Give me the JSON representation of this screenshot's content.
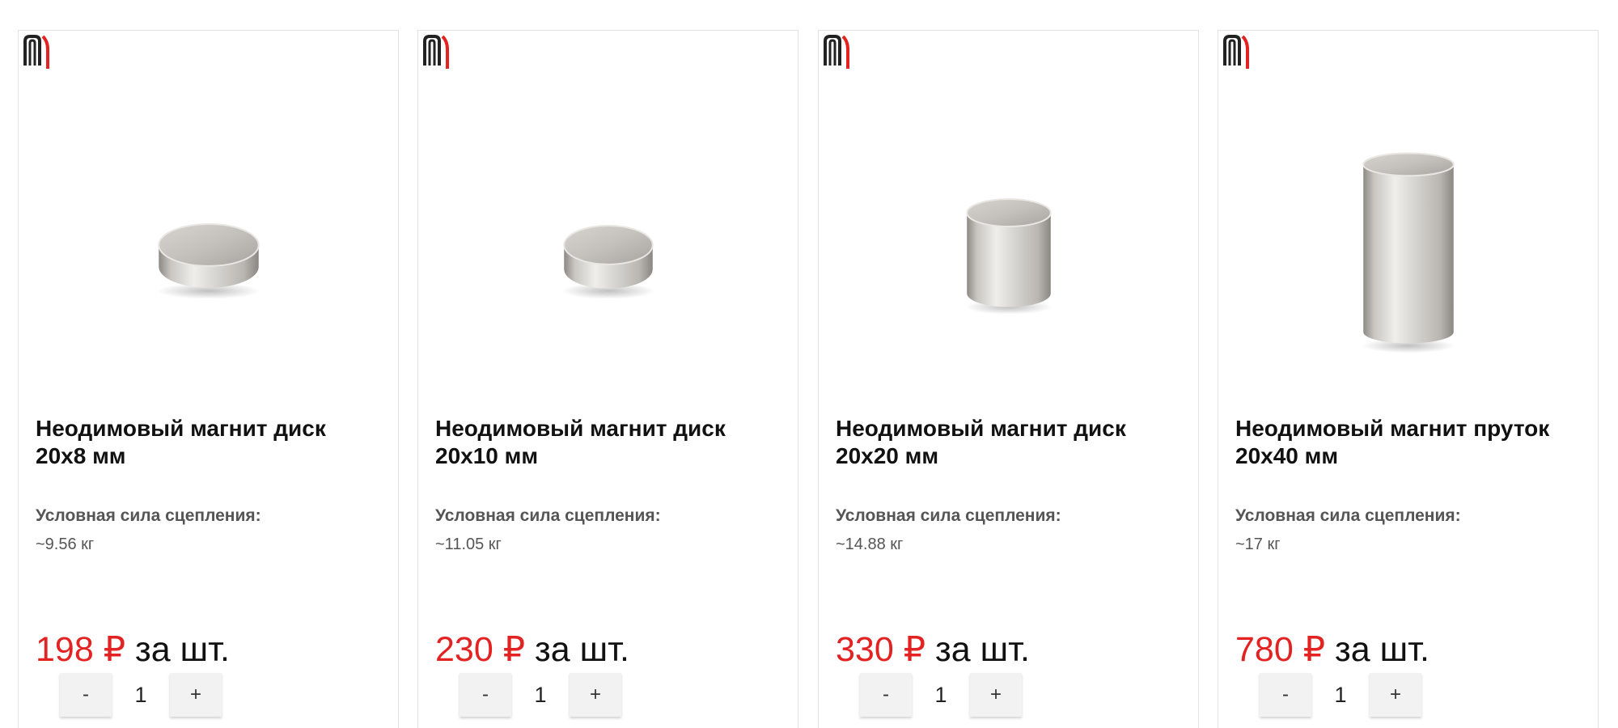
{
  "products": [
    {
      "title": "Неодимовый магнит диск 20х8 мм",
      "spec_label": "Условная сила сцепления:",
      "spec_value": "~9.56 кг",
      "price_amount": "198 ₽",
      "price_unit": " за шт.",
      "quantity": "1",
      "minus_label": "-",
      "plus_label": "+",
      "image_icon": "disc-magnet-image"
    },
    {
      "title": "Неодимовый магнит диск 20х10 мм",
      "spec_label": "Условная сила сцепления:",
      "spec_value": "~11.05 кг",
      "price_amount": "230 ₽",
      "price_unit": " за шт.",
      "quantity": "1",
      "minus_label": "-",
      "plus_label": "+",
      "image_icon": "disc-magnet-image"
    },
    {
      "title": "Неодимовый магнит диск 20х20 мм",
      "spec_label": "Условная сила сцепления:",
      "spec_value": "~14.88 кг",
      "price_amount": "330 ₽",
      "price_unit": " за шт.",
      "quantity": "1",
      "minus_label": "-",
      "plus_label": "+",
      "image_icon": "cylinder-magnet-image"
    },
    {
      "title": "Неодимовый магнит пруток 20х40 мм",
      "spec_label": "Условная сила сцепления:",
      "spec_value": "~17 кг",
      "price_amount": "780 ₽",
      "price_unit": " за шт.",
      "quantity": "1",
      "minus_label": "-",
      "plus_label": "+",
      "image_icon": "rod-magnet-image"
    }
  ],
  "colors": {
    "price_accent": "#e32222",
    "logo_red": "#e32222",
    "logo_dark": "#222222"
  }
}
